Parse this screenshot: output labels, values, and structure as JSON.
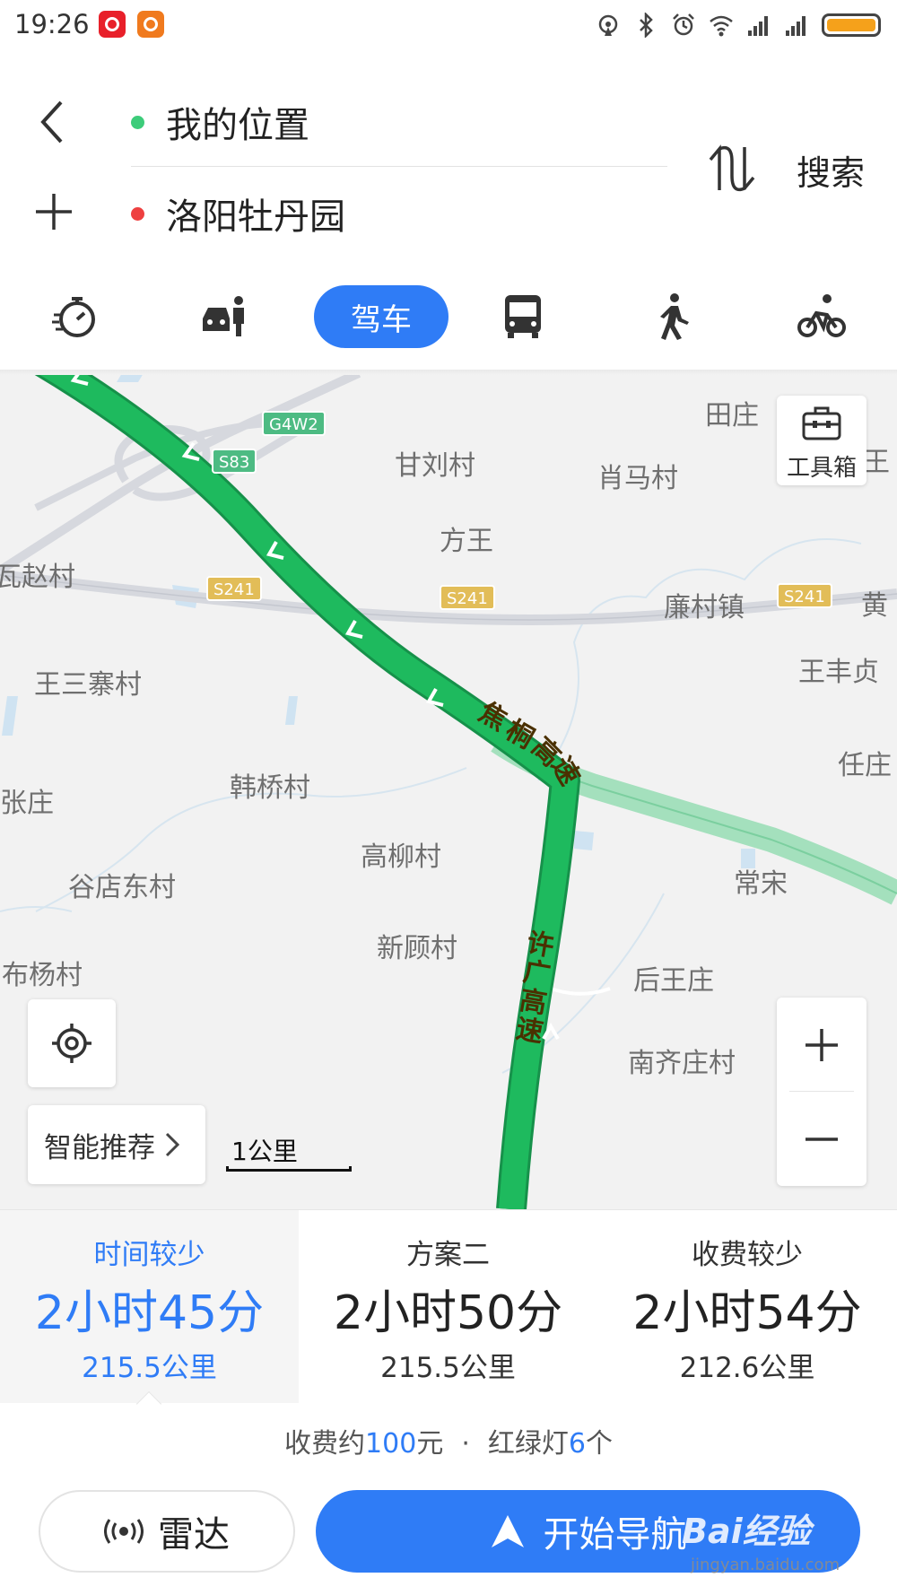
{
  "status_bar": {
    "time": "19:26",
    "battery_level": 1.0,
    "battery_color": "#f5a11b"
  },
  "route": {
    "start": "我的位置",
    "end": "洛阳牡丹园",
    "search_label": "搜索"
  },
  "modes": {
    "items": [
      "recommend-icon",
      "taxi-icon",
      "bus-icon",
      "walk-icon",
      "bike-icon"
    ],
    "selected_label": "驾车",
    "accent": "#2f7cf6"
  },
  "map": {
    "places": [
      "田庄",
      "甘刘村",
      "肖马村",
      "申王",
      "方王",
      "瓦赵村",
      "廉村镇",
      "黄",
      "王三寨村",
      "王丰贞",
      "韩桥村",
      "任庄",
      "张庄",
      "高柳村",
      "谷店东村",
      "常宋",
      "新顾村",
      "布杨村",
      "后王庄",
      "南齐庄村"
    ],
    "shields": [
      "G4W2",
      "S83",
      "S241",
      "S241",
      "S241"
    ],
    "road_labels": {
      "jiaotong": [
        "焦",
        "桐",
        "高",
        "速"
      ],
      "xuguang": [
        "许",
        "广",
        "高",
        "速"
      ]
    },
    "toolbox_label": "工具箱",
    "smart_recommend_label": "智能推荐",
    "scale_label": "1公里",
    "route_color": "#1eba5e"
  },
  "options": [
    {
      "title": "时间较少",
      "time": "2小时45分",
      "distance": "215.5公里",
      "selected": true
    },
    {
      "title": "方案二",
      "time": "2小时50分",
      "distance": "215.5公里",
      "selected": false
    },
    {
      "title": "收费较少",
      "time": "2小时54分",
      "distance": "212.6公里",
      "selected": false
    }
  ],
  "summary": {
    "toll_prefix": "收费约",
    "toll_value": "100",
    "toll_suffix": "元",
    "separator": "·",
    "lights_prefix": "红绿灯",
    "lights_value": "6",
    "lights_suffix": "个"
  },
  "actions": {
    "radar_label": "雷达",
    "navigate_label": "开始导航"
  },
  "watermark": {
    "main": "Bai经验",
    "sub": "jingyan.baidu.com"
  }
}
